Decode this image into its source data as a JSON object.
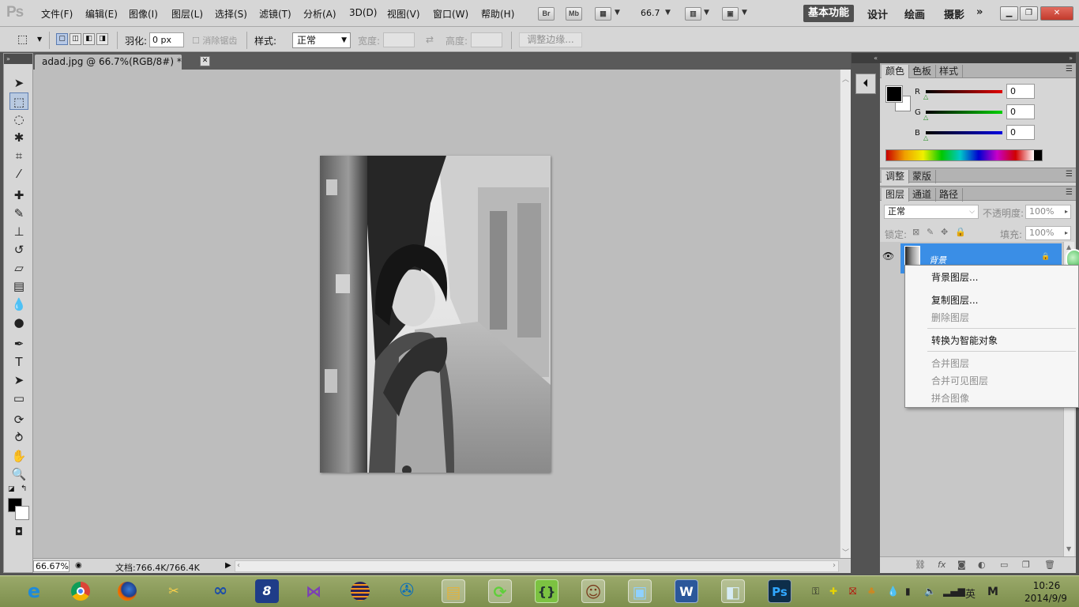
{
  "menubar": {
    "logo": "Ps",
    "items": [
      "文件(F)",
      "编辑(E)",
      "图像(I)",
      "图层(L)",
      "选择(S)",
      "滤镜(T)",
      "分析(A)",
      "3D(D)",
      "视图(V)",
      "窗口(W)",
      "帮助(H)"
    ],
    "bridge_btn": "Br",
    "minibridge_btn": "Mb",
    "zoom_value": "66.7",
    "workspaces": [
      "基本功能",
      "设计",
      "绘画",
      "摄影"
    ],
    "more": "»"
  },
  "options": {
    "feather_label": "羽化:",
    "feather_value": "0 px",
    "antialias_label": "消除锯齿",
    "style_label": "样式:",
    "style_value": "正常",
    "width_label": "宽度:",
    "height_label": "高度:",
    "refine_edge": "调整边缘..."
  },
  "document": {
    "tab_title": "adad.jpg @ 66.7%(RGB/8#) *",
    "zoom_percent": "66.67%",
    "doc_size": "文档:766.4K/766.4K"
  },
  "color_panel": {
    "tabs": [
      "颜色",
      "色板",
      "样式"
    ],
    "r_label": "R",
    "g_label": "G",
    "b_label": "B",
    "r_value": "0",
    "g_value": "0",
    "b_value": "0"
  },
  "adjust_panel": {
    "tabs": [
      "调整",
      "蒙版"
    ]
  },
  "layers_panel": {
    "tabs": [
      "图层",
      "通道",
      "路径"
    ],
    "blend_mode": "正常",
    "opacity_label": "不透明度:",
    "opacity_value": "100%",
    "lock_label": "锁定:",
    "fill_label": "填充:",
    "fill_value": "100%",
    "layer_name": "背景"
  },
  "context_menu": {
    "items": [
      {
        "label": "背景图层...",
        "enabled": true
      },
      {
        "label": "复制图层...",
        "enabled": true
      },
      {
        "label": "删除图层",
        "enabled": false
      },
      {
        "label": "转换为智能对象",
        "enabled": true
      },
      {
        "label": "合并图层",
        "enabled": false
      },
      {
        "label": "合并可见图层",
        "enabled": false
      },
      {
        "label": "拼合图像",
        "enabled": false
      }
    ]
  },
  "taskbar": {
    "apps": [
      "ie-icon",
      "chrome-icon",
      "firefox-icon",
      "tools-icon",
      "infinity-icon",
      "app-8-icon",
      "visual-studio-icon",
      "eclipse-icon",
      "media-icon",
      "folder-icon",
      "sync-icon",
      "brackets-icon",
      "avatar-icon",
      "photos-icon",
      "word-icon",
      "notepad-icon",
      "photoshop-icon"
    ],
    "ime_label": "英",
    "ime_mode": "M",
    "time": "10:26",
    "date": "2014/9/9"
  },
  "colors": {
    "accent_blue": "#3a8ee6",
    "panel_gray": "#d6d6d6",
    "canvas_gray": "#bdbdbd"
  }
}
